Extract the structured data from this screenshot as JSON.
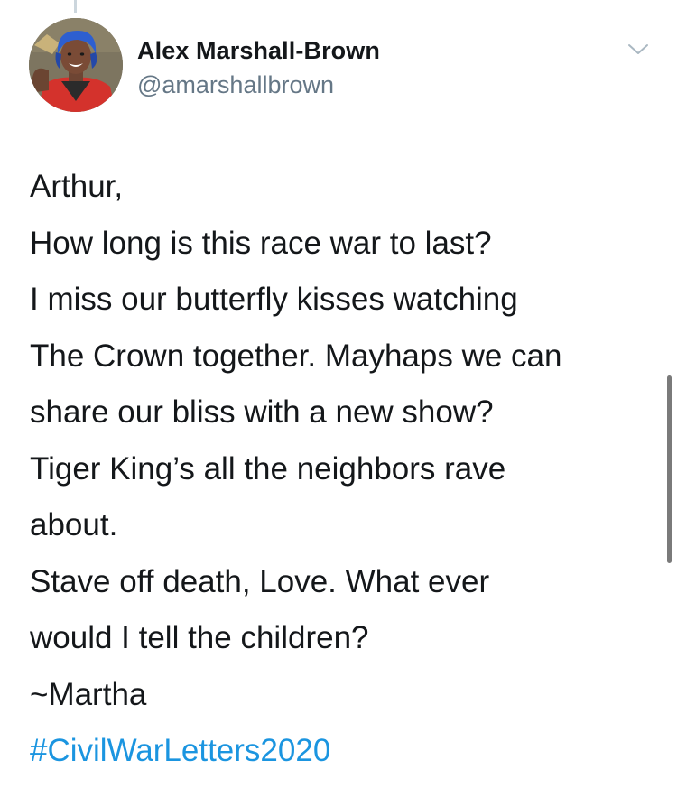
{
  "tweet": {
    "author": {
      "display_name": "Alex Marshall-Brown",
      "handle": "@amarshallbrown"
    },
    "menu_icon": "chevron-down-icon",
    "lines": [
      "Arthur,",
      "How long is this race war to last?",
      "I miss our butterfly kisses watching",
      "The Crown together. Mayhaps we can",
      "share our bliss with a new show?",
      "Tiger King’s all the neighbors rave",
      "about.",
      "Stave off death, Love. What ever",
      "would I tell the children?",
      "~Martha"
    ],
    "hashtag": "#CivilWarLetters2020"
  },
  "colors": {
    "text": "#14171a",
    "secondary": "#657786",
    "link": "#1b95e0"
  }
}
